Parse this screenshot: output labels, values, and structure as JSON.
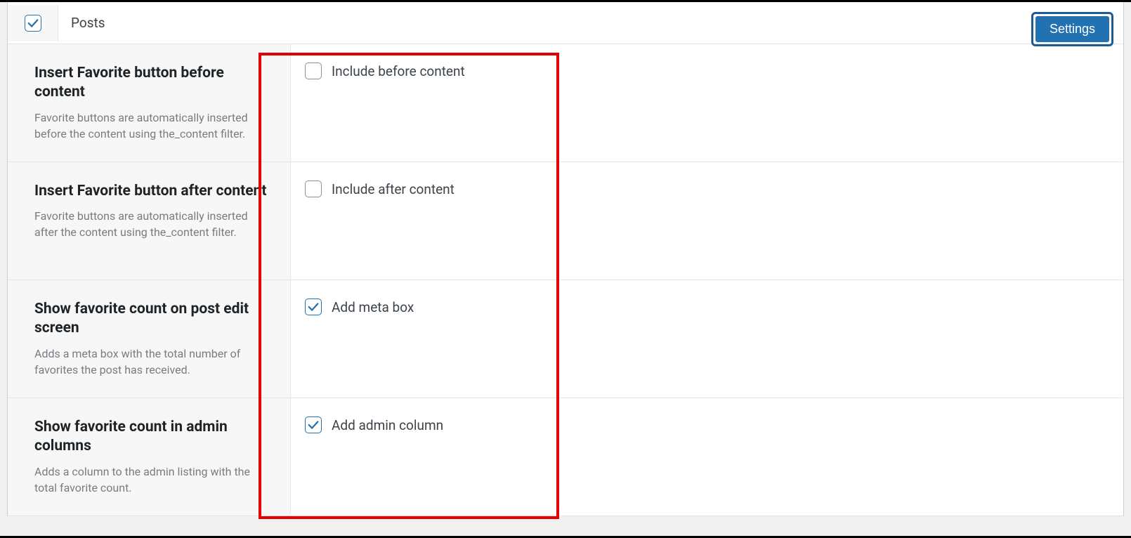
{
  "header": {
    "title": "Posts",
    "checked": true,
    "settings_label": "Settings"
  },
  "rows": [
    {
      "title": "Insert Favorite button before content",
      "desc": "Favorite buttons are automatically inserted before the content using the_content filter.",
      "option_label": "Include before content",
      "checked": false
    },
    {
      "title": "Insert Favorite button after content",
      "desc": "Favorite buttons are automatically inserted after the content using the_content filter.",
      "option_label": "Include after content",
      "checked": false
    },
    {
      "title": "Show favorite count on post edit screen",
      "desc": "Adds a meta box with the total number of favorites the post has received.",
      "option_label": "Add meta box",
      "checked": true
    },
    {
      "title": "Show favorite count in admin columns",
      "desc": "Adds a column to the admin listing with the total favorite count.",
      "option_label": "Add admin column",
      "checked": true
    }
  ]
}
